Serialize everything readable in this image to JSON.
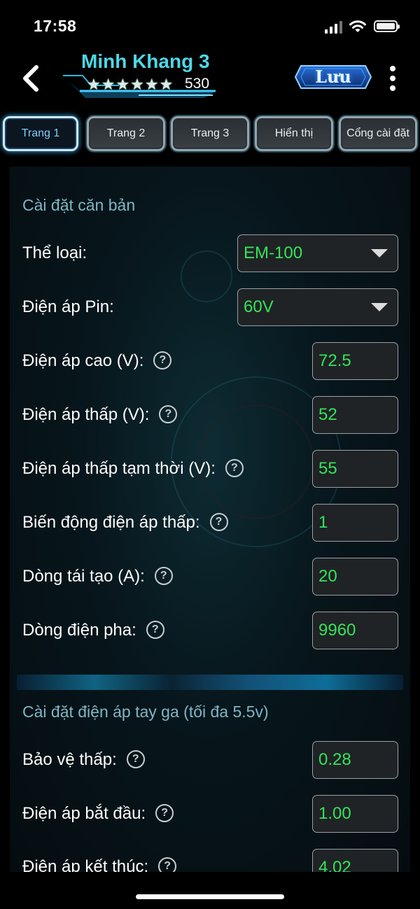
{
  "status_bar": {
    "time": "17:58"
  },
  "header": {
    "title": "Minh Khang 3",
    "stars": "★★★★★★",
    "rating_count": "530",
    "save_label": "Lưu"
  },
  "tabs": [
    {
      "label": "Trang 1",
      "active": true
    },
    {
      "label": "Trang 2"
    },
    {
      "label": "Trang 3"
    },
    {
      "label": "Hiển thị"
    },
    {
      "label": "Cổng cài đặt"
    }
  ],
  "basic_settings": {
    "title": "Cài đặt căn bản",
    "type": {
      "label": "Thể loại:",
      "value": "EM-100"
    },
    "battery_voltage": {
      "label": "Điện áp Pin:",
      "value": "60V"
    },
    "high_voltage": {
      "label": "Điện áp cao (V):",
      "value": "72.5"
    },
    "low_voltage": {
      "label": "Điện áp thấp (V):",
      "value": "52"
    },
    "temp_low_voltage": {
      "label": "Điện áp thấp tạm thời (V):",
      "value": "55"
    },
    "low_voltage_fluctuation": {
      "label": "Biến động điện áp thấp:",
      "value": "1"
    },
    "regen_current": {
      "label": "Dòng tái tạo (A):",
      "value": "20"
    },
    "phase_current": {
      "label": "Dòng điện pha:",
      "value": "9960"
    }
  },
  "throttle_settings": {
    "title": "Cài đặt điện áp tay ga (tối đa 5.5v)",
    "low_protection": {
      "label": "Bảo vệ thấp:",
      "value": "0.28"
    },
    "start_voltage": {
      "label": "Điện áp bắt đầu:",
      "value": "1.00"
    },
    "end_voltage": {
      "label": "Điện áp kết thúc:",
      "value": "4.02"
    }
  },
  "help_symbol": "?"
}
